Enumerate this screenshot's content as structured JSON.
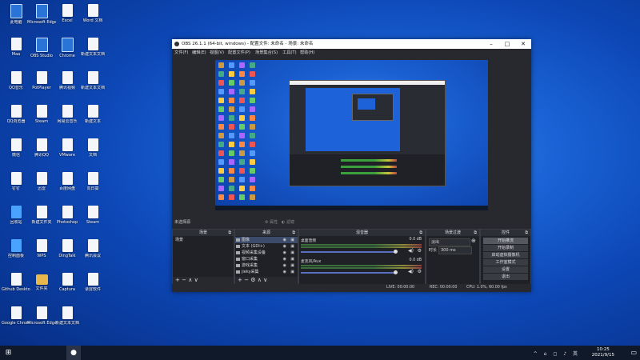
{
  "desktop_icons": [
    {
      "label": "此电脑",
      "style": "app"
    },
    {
      "label": "Microsoft Edge",
      "style": "app"
    },
    {
      "label": "Excel",
      "style": "doc"
    },
    {
      "label": "Word 文档",
      "style": "doc"
    },
    {
      "label": "Maa",
      "style": "doc"
    },
    {
      "label": "OBS Studio",
      "style": "app"
    },
    {
      "label": "Chrome",
      "style": "app"
    },
    {
      "label": "新建文本文档",
      "style": "doc"
    },
    {
      "label": "QQ音乐",
      "style": "doc"
    },
    {
      "label": "PotPlayer",
      "style": "doc"
    },
    {
      "label": "腾讯视频",
      "style": "doc"
    },
    {
      "label": "新建文本文档",
      "style": "doc"
    },
    {
      "label": "QQ浏览器",
      "style": "doc"
    },
    {
      "label": "Steam",
      "style": "doc"
    },
    {
      "label": "网易云音乐",
      "style": "doc"
    },
    {
      "label": "新建文本",
      "style": "doc"
    },
    {
      "label": "微信",
      "style": "doc"
    },
    {
      "label": "腾讯QQ",
      "style": "doc"
    },
    {
      "label": "VMware",
      "style": "doc"
    },
    {
      "label": "文档",
      "style": "doc"
    },
    {
      "label": "钉钉",
      "style": "doc"
    },
    {
      "label": "迅雷",
      "style": "doc"
    },
    {
      "label": "百度网盘",
      "style": "doc"
    },
    {
      "label": "向日葵",
      "style": "doc"
    },
    {
      "label": "回收站",
      "style": "blue"
    },
    {
      "label": "新建文件夹",
      "style": "doc"
    },
    {
      "label": "Photoshop",
      "style": "doc"
    },
    {
      "label": "Steam",
      "style": "doc"
    },
    {
      "label": "控制面板",
      "style": "blue"
    },
    {
      "label": "WPS",
      "style": "doc"
    },
    {
      "label": "DingTalk",
      "style": "doc"
    },
    {
      "label": "腾讯会议",
      "style": "doc"
    },
    {
      "label": "Github Desktop",
      "style": "doc"
    },
    {
      "label": "文件夹",
      "style": "folder"
    },
    {
      "label": "Captura",
      "style": "doc"
    },
    {
      "label": "录屏软件",
      "style": "doc"
    },
    {
      "label": "Google Chrome",
      "style": "doc"
    },
    {
      "label": "Microsoft Edge",
      "style": "doc"
    },
    {
      "label": "新建文本文档",
      "style": "doc"
    }
  ],
  "obs": {
    "title": "OBS 26.1.1 (64-bit, windows) - 配置文件: 未命名 - 场景: 未命名",
    "window_controls": {
      "minimize": "–",
      "maximize": "□",
      "close": "✕"
    },
    "menu": [
      "文件(F)",
      "编辑(E)",
      "视图(V)",
      "配置文件(P)",
      "场景集合(S)",
      "工具(T)",
      "帮助(H)"
    ],
    "no_source_selected": "未选择源",
    "props_button": "属性",
    "filters_button": "滤镜",
    "scenes": {
      "title": "场景",
      "items": [
        "场景"
      ]
    },
    "sources": {
      "title": "来源",
      "items": [
        {
          "name": "图像",
          "icon": "image-icon"
        },
        {
          "name": "文本 (GDI+)",
          "icon": "text-icon"
        },
        {
          "name": "视频采集设备",
          "icon": "camera-icon"
        },
        {
          "name": "窗口采集",
          "icon": "window-icon"
        },
        {
          "name": "游戏采集",
          "icon": "game-icon"
        },
        {
          "name": "jieky采集",
          "icon": "display-icon"
        }
      ]
    },
    "mixer": {
      "title": "混音器",
      "channels": [
        {
          "name": "桌面音频",
          "db": "0.0 dB"
        },
        {
          "name": "麦克风/Aux",
          "db": "0.0 dB"
        }
      ]
    },
    "transitions": {
      "title": "场景过渡",
      "type": "淡出",
      "duration_label": "时长",
      "duration_value": "300 ms"
    },
    "controls": {
      "title": "控件",
      "buttons": [
        "开始推流",
        "开始录制",
        "启动虚拟摄像机",
        "工作室模式",
        "设置",
        "退出"
      ]
    },
    "status": {
      "live": "LIVE: 00:00:00",
      "rec": "REC: 00:00:00",
      "cpu": "CPU: 1.0%, 60.00 fps"
    }
  },
  "taskbar": {
    "time": "10:25",
    "date": "2021/9/15",
    "tray": "^ ⌂ ◻ ♪ 英"
  },
  "colors": {
    "accent": "#1a63d6",
    "obs_bg": "#27292f",
    "dock_bg": "#1f2126"
  }
}
